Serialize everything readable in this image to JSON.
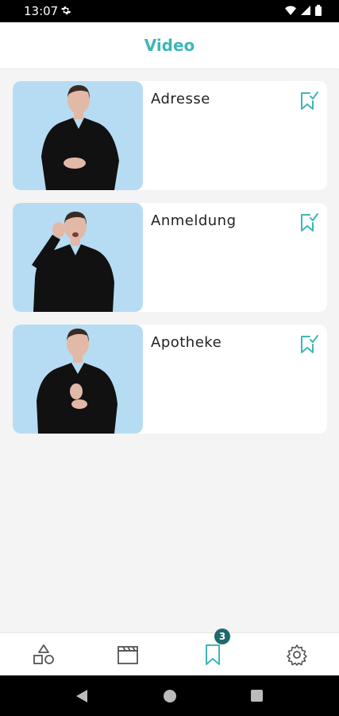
{
  "status_bar": {
    "time": "13:07"
  },
  "app_bar": {
    "title": "Video"
  },
  "items": [
    {
      "label": "Adresse"
    },
    {
      "label": "Anmeldung"
    },
    {
      "label": "Apotheke"
    }
  ],
  "bottom_nav": {
    "items": [
      {
        "icon": "shapes-icon"
      },
      {
        "icon": "clapperboard-icon"
      },
      {
        "icon": "bookmark-icon",
        "badge": "3",
        "active": true
      },
      {
        "icon": "gear-icon"
      }
    ]
  },
  "colors": {
    "accent": "#3eb6b6",
    "badge": "#1f6b6b",
    "thumb_bg": "#b6dcf3"
  }
}
